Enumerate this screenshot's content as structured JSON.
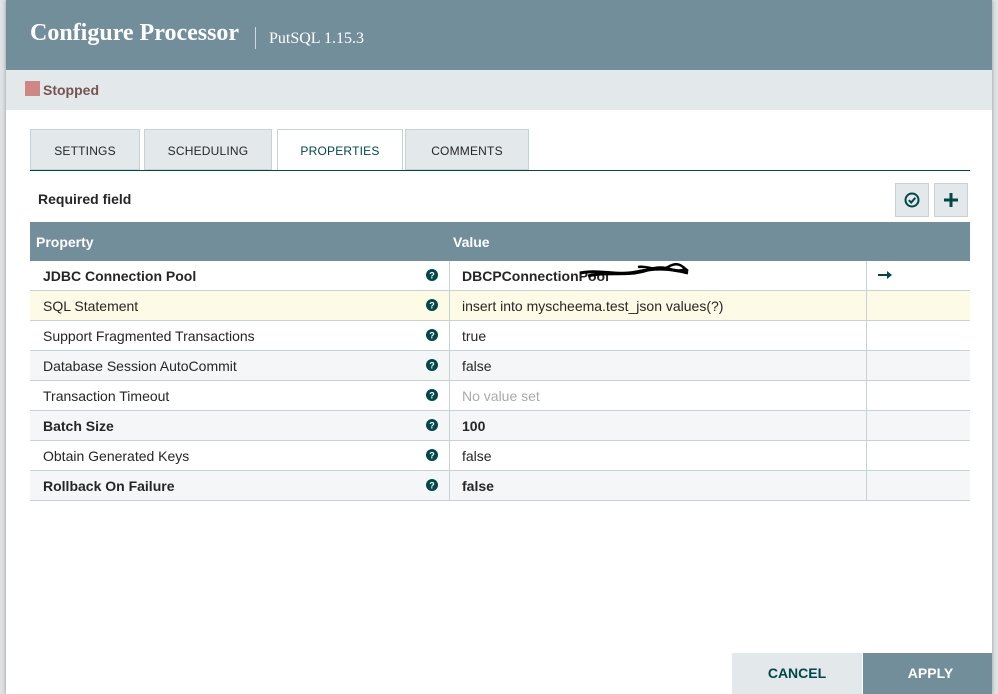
{
  "dialog": {
    "title": "Configure Processor",
    "subtitle": "PutSQL 1.15.3",
    "status": "Stopped"
  },
  "tabs": [
    "SETTINGS",
    "SCHEDULING",
    "PROPERTIES",
    "COMMENTS"
  ],
  "active_tab": "PROPERTIES",
  "required_label": "Required field",
  "toolbar": {
    "verify_icon": "check-circle-icon",
    "add_icon": "plus-icon"
  },
  "table": {
    "headers": {
      "property": "Property",
      "value": "Value"
    },
    "rows": [
      {
        "name": "JDBC Connection Pool",
        "value": "DBCPConnectionPool",
        "required": true
      },
      {
        "name": "SQL Statement",
        "value": "insert into myscheema.test_json values(?)",
        "required": false
      },
      {
        "name": "Support Fragmented Transactions",
        "value": "true",
        "required": false
      },
      {
        "name": "Database Session AutoCommit",
        "value": "false",
        "required": false
      },
      {
        "name": "Transaction Timeout",
        "value": "No value set",
        "required": false
      },
      {
        "name": "Batch Size",
        "value": "100",
        "required": true
      },
      {
        "name": "Obtain Generated Keys",
        "value": "false",
        "required": false
      },
      {
        "name": "Rollback On Failure",
        "value": "false",
        "required": true
      }
    ]
  },
  "footer": {
    "cancel_label": "CANCEL",
    "apply_label": "APPLY"
  },
  "colors": {
    "header": "#728e9b",
    "accent": "#004849",
    "status_stopped": "#d18686"
  }
}
